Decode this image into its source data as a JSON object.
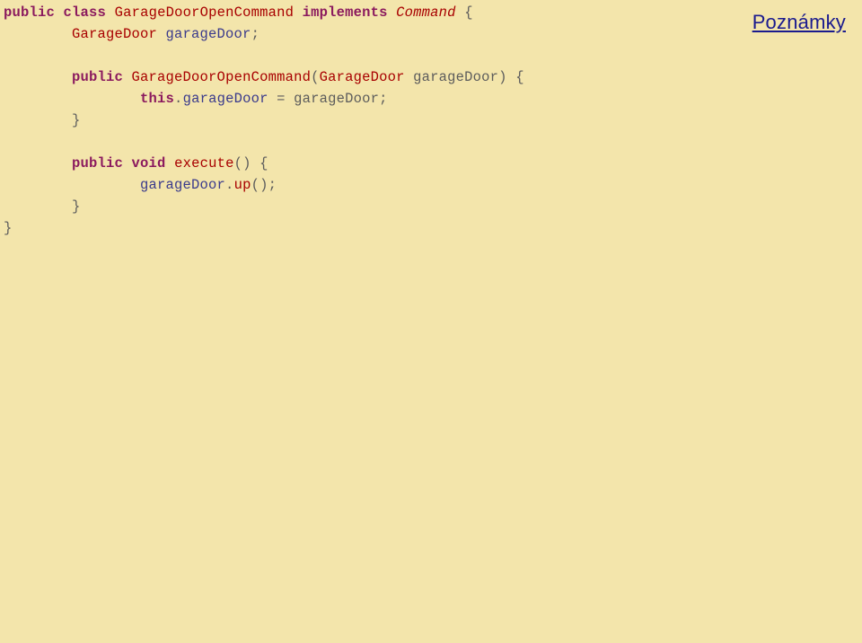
{
  "notes": {
    "label": "Poznámky"
  },
  "code": {
    "kw_public": "public",
    "kw_class": "class",
    "kw_implements": "implements",
    "kw_void": "void",
    "kw_this": "this",
    "class_main": "GarageDoorOpenCommand",
    "class_command": "Command",
    "class_garagedoor": "GarageDoor",
    "field_garagedoor": "garageDoor",
    "method_execute": "execute",
    "method_up": "up",
    "brace_open": "{",
    "brace_close": "}",
    "semicolon": ";",
    "paren_open": "(",
    "paren_close": ")",
    "dot": ".",
    "comma_space": " ",
    "equals": " = ",
    "constructor_name": "GarageDoorOpenCommand"
  }
}
